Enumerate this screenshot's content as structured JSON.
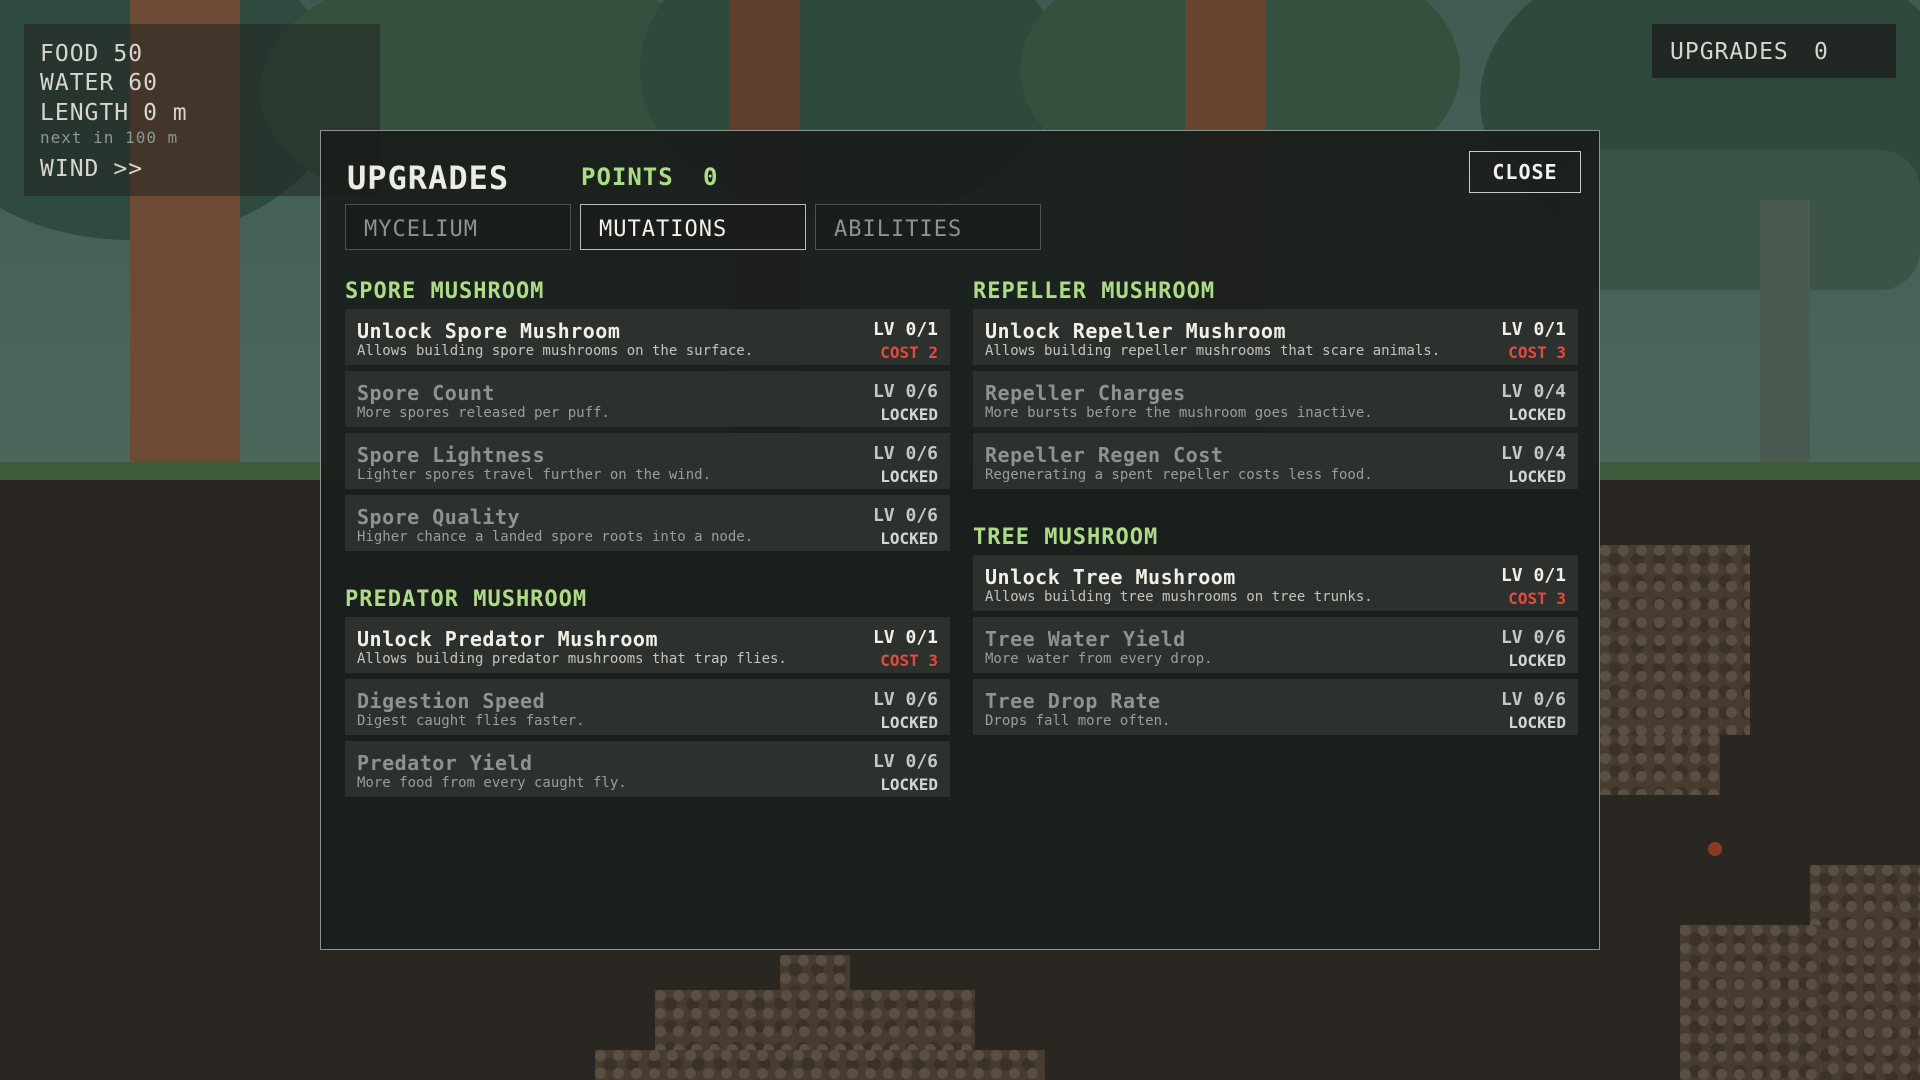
{
  "hud": {
    "food_label": "FOOD",
    "food_value": "50",
    "water_label": "WATER",
    "water_value": "60",
    "length_label": "LENGTH",
    "length_value": "0 m",
    "next_text": "next in 100 m",
    "wind_label": "WIND",
    "wind_value": ">>"
  },
  "upgrades_hud": {
    "label": "UPGRADES",
    "value": "0"
  },
  "panel": {
    "title": "UPGRADES",
    "points_label": "POINTS",
    "points_value": "0",
    "close_label": "CLOSE",
    "tabs": [
      {
        "label": "MYCELIUM",
        "active": false
      },
      {
        "label": "MUTATIONS",
        "active": true
      },
      {
        "label": "ABILITIES",
        "active": false
      }
    ],
    "sections": [
      {
        "title": "SPORE MUSHROOM",
        "items": [
          {
            "name": "Unlock Spore Mushroom",
            "desc": "Allows building spore mushrooms on the surface.",
            "level": "LV 0/1",
            "status": "COST 2",
            "locked": false
          },
          {
            "name": "Spore Count",
            "desc": "More spores released per puff.",
            "level": "LV 0/6",
            "status": "LOCKED",
            "locked": true
          },
          {
            "name": "Spore Lightness",
            "desc": "Lighter spores travel further on the wind.",
            "level": "LV 0/6",
            "status": "LOCKED",
            "locked": true
          },
          {
            "name": "Spore Quality",
            "desc": "Higher chance a landed spore roots into a node.",
            "level": "LV 0/6",
            "status": "LOCKED",
            "locked": true
          }
        ]
      },
      {
        "title": "PREDATOR MUSHROOM",
        "items": [
          {
            "name": "Unlock Predator Mushroom",
            "desc": "Allows building predator mushrooms that trap flies.",
            "level": "LV 0/1",
            "status": "COST 3",
            "locked": false
          },
          {
            "name": "Digestion Speed",
            "desc": "Digest caught flies faster.",
            "level": "LV 0/6",
            "status": "LOCKED",
            "locked": true
          },
          {
            "name": "Predator Yield",
            "desc": "More food from every caught fly.",
            "level": "LV 0/6",
            "status": "LOCKED",
            "locked": true
          }
        ]
      },
      {
        "title": "REPELLER MUSHROOM",
        "items": [
          {
            "name": "Unlock Repeller Mushroom",
            "desc": "Allows building repeller mushrooms that scare animals.",
            "level": "LV 0/1",
            "status": "COST 3",
            "locked": false
          },
          {
            "name": "Repeller Charges",
            "desc": "More bursts before the mushroom goes inactive.",
            "level": "LV 0/4",
            "status": "LOCKED",
            "locked": true
          },
          {
            "name": "Repeller Regen Cost",
            "desc": "Regenerating a spent repeller costs less food.",
            "level": "LV 0/4",
            "status": "LOCKED",
            "locked": true
          }
        ]
      },
      {
        "title": "TREE MUSHROOM",
        "items": [
          {
            "name": "Unlock Tree Mushroom",
            "desc": "Allows building tree mushrooms on tree trunks.",
            "level": "LV 0/1",
            "status": "COST 3",
            "locked": false
          },
          {
            "name": "Tree Water Yield",
            "desc": "More water from every drop.",
            "level": "LV 0/6",
            "status": "LOCKED",
            "locked": true
          },
          {
            "name": "Tree Drop Rate",
            "desc": "Drops fall more often.",
            "level": "LV 0/6",
            "status": "LOCKED",
            "locked": true
          }
        ]
      }
    ]
  },
  "colors": {
    "accent_green": "#aedc86",
    "cost_red": "#e04c3e",
    "panel_bg": "#1a1e1c",
    "card_bg": "#2c312e"
  }
}
